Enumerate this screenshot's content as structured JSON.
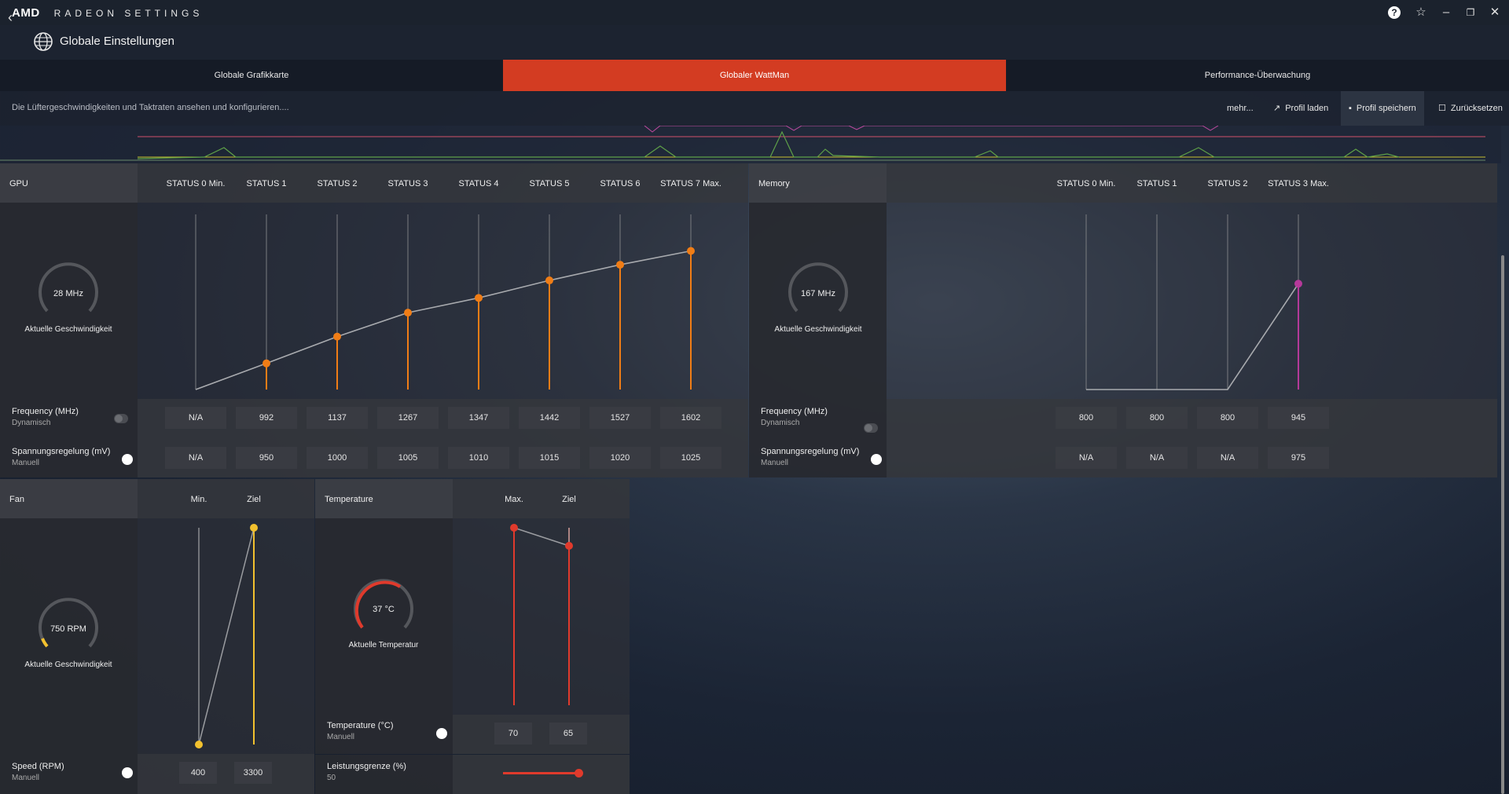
{
  "app": {
    "brand": "AMD",
    "product": "RADEON SETTINGS"
  },
  "nav": {
    "title": "Globale Einstellungen"
  },
  "tabs": [
    {
      "label": "Globale Grafikkarte",
      "active": false
    },
    {
      "label": "Globaler WattMan",
      "active": true
    },
    {
      "label": "Performance-Überwachung",
      "active": false
    }
  ],
  "infobar": {
    "text": "Die Lüftergeschwindigkeiten und Taktraten ansehen und konfigurieren....",
    "more": "mehr...",
    "load": "Profil laden",
    "save": "Profil speichern",
    "reset": "Zurücksetzen"
  },
  "gpu": {
    "title": "GPU",
    "states": [
      "STATUS 0 Min.",
      "STATUS 1",
      "STATUS 2",
      "STATUS 3",
      "STATUS 4",
      "STATUS 5",
      "STATUS 6",
      "STATUS 7 Max."
    ],
    "gauge": {
      "value": "28 MHz",
      "label": "Aktuelle Geschwindigkeit"
    },
    "frequency": {
      "label": "Frequency (MHz)",
      "mode": "Dynamisch",
      "values": [
        "N/A",
        "992",
        "1137",
        "1267",
        "1347",
        "1442",
        "1527",
        "1602"
      ]
    },
    "voltage": {
      "label": "Spannungsregelung (mV)",
      "mode": "Manuell",
      "values": [
        "N/A",
        "950",
        "1000",
        "1005",
        "1010",
        "1015",
        "1020",
        "1025"
      ]
    },
    "accent": "#f07d16"
  },
  "memory": {
    "title": "Memory",
    "states": [
      "STATUS 0 Min.",
      "STATUS 1",
      "STATUS 2",
      "STATUS 3 Max."
    ],
    "gauge": {
      "value": "167 MHz",
      "label": "Aktuelle Geschwindigkeit"
    },
    "frequency": {
      "label": "Frequency (MHz)",
      "mode": "Dynamisch",
      "values": [
        "800",
        "800",
        "800",
        "945"
      ]
    },
    "voltage": {
      "label": "Spannungsregelung (mV)",
      "mode": "Manuell",
      "values": [
        "N/A",
        "N/A",
        "N/A",
        "975"
      ]
    },
    "accent": "#b5399a"
  },
  "fan": {
    "title": "Fan",
    "cols": [
      "Min.",
      "Ziel"
    ],
    "gauge": {
      "value": "750 RPM",
      "label": "Aktuelle Geschwindigkeit"
    },
    "speed": {
      "label": "Speed (RPM)",
      "mode": "Manuell",
      "values": [
        "400",
        "3300"
      ]
    },
    "accent": "#f2c12e"
  },
  "temperature": {
    "title": "Temperature",
    "cols": [
      "Max.",
      "Ziel"
    ],
    "gauge": {
      "value": "37 °C",
      "label": "Aktuelle Temperatur"
    },
    "temp": {
      "label": "Temperature (°C)",
      "mode": "Manuell",
      "values": [
        "70",
        "65"
      ]
    },
    "power": {
      "label": "Leistungsgrenze (%)",
      "value": "50"
    },
    "accent": "#e03a2c"
  }
}
